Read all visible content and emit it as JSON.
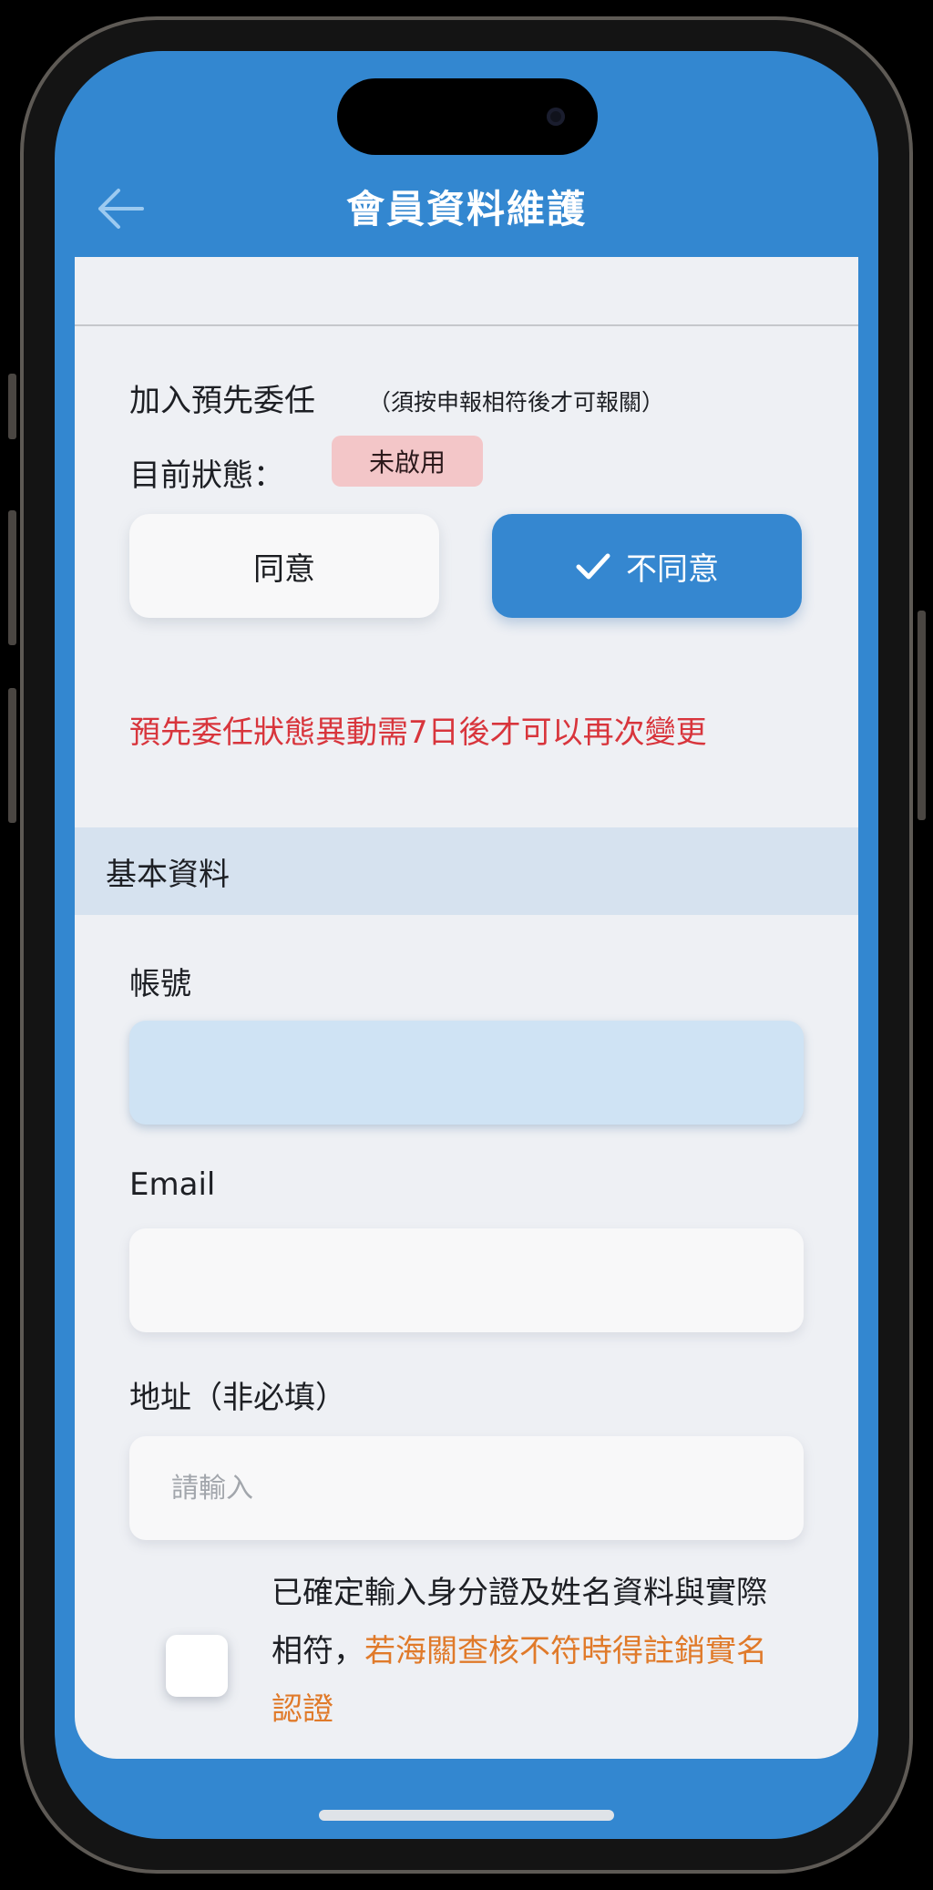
{
  "header": {
    "title": "會員資料維護",
    "back_icon": "arrow-left-icon"
  },
  "delegation": {
    "title": "加入預先委任",
    "note": "（須按申報相符後才可報關）",
    "status_label": "目前狀態：",
    "status_value": "未啟用",
    "agree_label": "同意",
    "disagree_label": "不同意",
    "selected": "disagree",
    "warning": "預先委任狀態異動需7日後才可以再次變更"
  },
  "basic_info": {
    "section_title": "基本資料",
    "account_label": "帳號",
    "account_value": "",
    "email_label": "Email",
    "email_value": "",
    "address_label": "地址（非必填）",
    "address_placeholder": "請輸入"
  },
  "confirm": {
    "checked": false,
    "text_part1": "已確定輸入身分證及姓名資料與實際相符，",
    "text_part2": "若海關查核不符時得註銷實名認證"
  },
  "colors": {
    "primary": "#3387d0",
    "warning_red": "#d8353c",
    "warning_orange": "#e07a2a",
    "badge_bg": "#f3c6c8"
  }
}
